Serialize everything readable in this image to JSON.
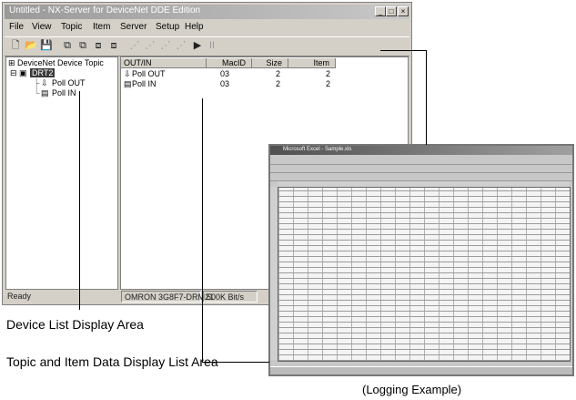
{
  "window": {
    "title": "Untitled - NX-Server for DeviceNet DDE Edition",
    "controls": {
      "minimize": "_",
      "maximize": "□",
      "close": "×"
    }
  },
  "menu": [
    "File",
    "View",
    "Topic",
    "Item",
    "Server",
    "Setup",
    "Help"
  ],
  "toolbar": {
    "icons": [
      "new-icon",
      "open-icon",
      "save-icon",
      "topic-icon",
      "topic-add-icon",
      "item-icon",
      "item-add-icon",
      "item-a-icon",
      "item-b-icon",
      "item-c-icon",
      "item-d-icon",
      "run-icon",
      "stop-icon"
    ],
    "run_symbol": "▶",
    "stop_symbol": "II"
  },
  "tree": {
    "root": "DeviceNet Device Topic",
    "node": "DRT2",
    "children": [
      "Poll OUT",
      "Poll IN"
    ]
  },
  "list": {
    "columns": [
      "OUT/IN",
      "MacID",
      "Size",
      "Item"
    ],
    "rows": [
      {
        "name": "Poll OUT",
        "macid": "03",
        "size": "2",
        "item": "2"
      },
      {
        "name": "Poll IN",
        "macid": "03",
        "size": "2",
        "item": "2"
      }
    ]
  },
  "status": {
    "left": "Ready",
    "device": "OMRON 3G8F7-DRM21",
    "rate": "500K Bit/s"
  },
  "captions": {
    "device_list": "Device List Display Area",
    "topic_item": "Topic and Item Data Display List Area",
    "logging": "(Logging Example)"
  },
  "excel": {
    "title": "Microsoft Excel - Sample.xls"
  }
}
